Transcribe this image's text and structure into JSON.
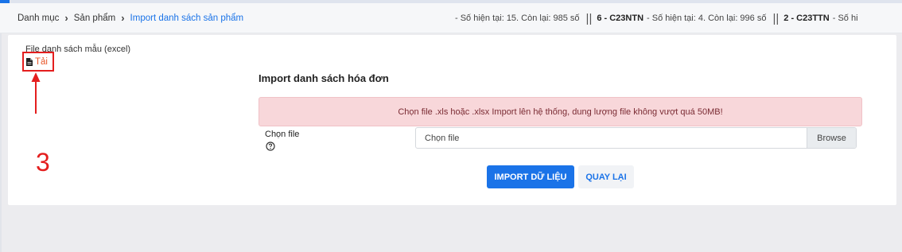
{
  "breadcrumb": {
    "items": [
      "Danh mục",
      "Sản phẩm"
    ],
    "current": "Import danh sách sản phẩm"
  },
  "ticker": {
    "segments": [
      {
        "code": "",
        "text": "- Số hiện tại: 15. Còn lại: 985 số"
      },
      {
        "code": "6 - C23NTN",
        "text": "- Số hiện tại: 4. Còn lại: 996 số"
      },
      {
        "code": "2 - C23TTN",
        "text": "- Số hi"
      }
    ]
  },
  "sample": {
    "label": "File danh sách mẫu (excel)",
    "download_label": "Tải"
  },
  "annotation": {
    "step_number": "3"
  },
  "form": {
    "title": "Import danh sách hóa đơn",
    "alert": "Chọn file .xls hoặc .xlsx Import lên hệ thống, dung lượng file không vượt quá 50MB!",
    "file_label": "Chọn file",
    "file_placeholder": "Chọn file",
    "browse_label": "Browse",
    "import_button": "IMPORT DỮ LIỆU",
    "back_button": "QUAY LẠI"
  },
  "colors": {
    "primary": "#1a73e8",
    "alert_bg": "#f8d7da",
    "annotation_red": "#e41e1e",
    "download_orange": "#e8572a"
  },
  "icons": [
    "chevron-right-icon",
    "file-icon",
    "question-circle-icon",
    "arrow-up-icon"
  ]
}
